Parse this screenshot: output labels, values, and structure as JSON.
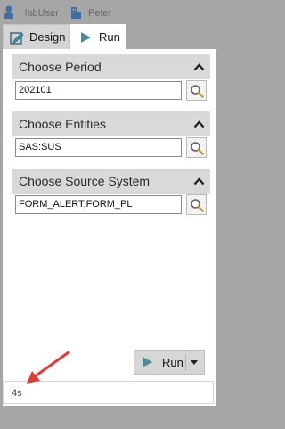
{
  "topbar": {
    "user_icon": "person-icon",
    "user": "labUser",
    "entity_icon": "building-icon",
    "entity": "Peter"
  },
  "tabs": [
    {
      "label": "Design",
      "icon": "design-icon",
      "active": false
    },
    {
      "label": "Run",
      "icon": "play-icon",
      "active": true
    }
  ],
  "sections": [
    {
      "title": "Choose Period",
      "value": "202101",
      "collapse_icon": "chevron-up-icon",
      "search_icon": "magnifier-icon"
    },
    {
      "title": "Choose Entities",
      "value": "SAS:SUS",
      "collapse_icon": "chevron-up-icon",
      "search_icon": "magnifier-icon"
    },
    {
      "title": "Choose Source System",
      "value": "FORM_ALERT,FORM_PL",
      "collapse_icon": "chevron-up-icon",
      "search_icon": "magnifier-icon"
    }
  ],
  "run_button": {
    "label": "Run",
    "icon": "play-icon",
    "dropdown_icon": "caret-down-icon"
  },
  "status": {
    "elapsed": "4s"
  },
  "colors": {
    "accent": "#4a90a4",
    "arrow": "#e03b3b",
    "header_bg": "#d9d9d9",
    "frame_bg": "#a6a6a6"
  }
}
